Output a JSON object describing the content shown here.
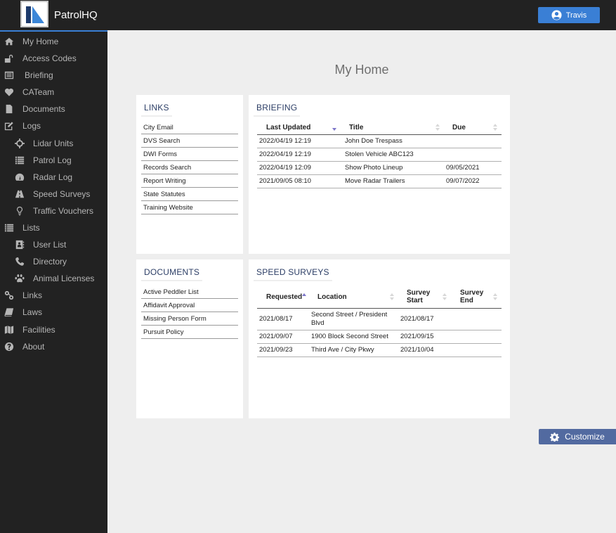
{
  "app": {
    "brand": "PatrolHQ",
    "user_name": "Travis",
    "accent_color": "#3a7fd5"
  },
  "sidebar": {
    "items": [
      {
        "label": "My Home",
        "icon": "home-icon",
        "level": 0
      },
      {
        "label": "Access Codes",
        "icon": "unlock-icon",
        "level": 0
      },
      {
        "label": "Briefing",
        "icon": "list-alt-icon",
        "level": 0
      },
      {
        "label": "CATeam",
        "icon": "heart-icon",
        "level": 0
      },
      {
        "label": "Documents",
        "icon": "file-icon",
        "level": 0
      },
      {
        "label": "Logs",
        "icon": "edit-icon",
        "level": 0
      },
      {
        "label": "Lidar Units",
        "icon": "crosshairs-icon",
        "level": 1
      },
      {
        "label": "Patrol Log",
        "icon": "list-icon",
        "level": 1
      },
      {
        "label": "Radar Log",
        "icon": "tachometer-icon",
        "level": 1
      },
      {
        "label": "Speed Surveys",
        "icon": "road-icon",
        "level": 1
      },
      {
        "label": "Traffic Vouchers",
        "icon": "lightbulb-icon",
        "level": 1
      },
      {
        "label": "Lists",
        "icon": "list-icon",
        "level": 0
      },
      {
        "label": "User List",
        "icon": "address-book-icon",
        "level": 1
      },
      {
        "label": "Directory",
        "icon": "phone-icon",
        "level": 1
      },
      {
        "label": "Animal Licenses",
        "icon": "paw-icon",
        "level": 1
      },
      {
        "label": "Links",
        "icon": "link-icon",
        "level": 0
      },
      {
        "label": "Laws",
        "icon": "book-icon",
        "level": 0
      },
      {
        "label": "Facilities",
        "icon": "map-icon",
        "level": 0
      },
      {
        "label": "About",
        "icon": "question-circle-icon",
        "level": 0
      }
    ]
  },
  "main": {
    "title": "My Home",
    "customize_label": "Customize",
    "links_card": {
      "title": "LINKS",
      "items": [
        "City Email",
        "DVS Search",
        "DWI Forms",
        "Records Search",
        "Report Writing",
        "State Statutes",
        "Training Website"
      ]
    },
    "documents_card": {
      "title": "DOCUMENTS",
      "items": [
        "Active Peddler List",
        "Affidavit Approval",
        "Missing Person Form",
        "Pursuit Policy"
      ]
    },
    "briefing_card": {
      "title": "BRIEFING",
      "columns": [
        "Last Updated",
        "Title",
        "Due"
      ],
      "sort": {
        "column": "Last Updated",
        "direction": "desc"
      },
      "rows": [
        [
          "2022/04/19 12:19",
          "John Doe Trespass",
          ""
        ],
        [
          "2022/04/19 12:19",
          "Stolen Vehicle ABC123",
          ""
        ],
        [
          "2022/04/19 12:09",
          "Show Photo Lineup",
          "09/05/2021"
        ],
        [
          "2021/09/05 08:10",
          "Move Radar Trailers",
          "09/07/2022"
        ]
      ]
    },
    "speed_surveys_card": {
      "title": "SPEED SURVEYS",
      "columns": [
        "Requested",
        "Location",
        "Survey Start",
        "Survey End"
      ],
      "sort": {
        "column": "Requested",
        "direction": "asc"
      },
      "rows": [
        [
          "2021/08/17",
          "Second Street / President Blvd",
          "2021/08/17",
          ""
        ],
        [
          "2021/09/07",
          "1900 Block Second Street",
          "2021/09/15",
          ""
        ],
        [
          "2021/09/23",
          "Third Ave / City Pkwy",
          "2021/10/04",
          ""
        ]
      ]
    }
  }
}
